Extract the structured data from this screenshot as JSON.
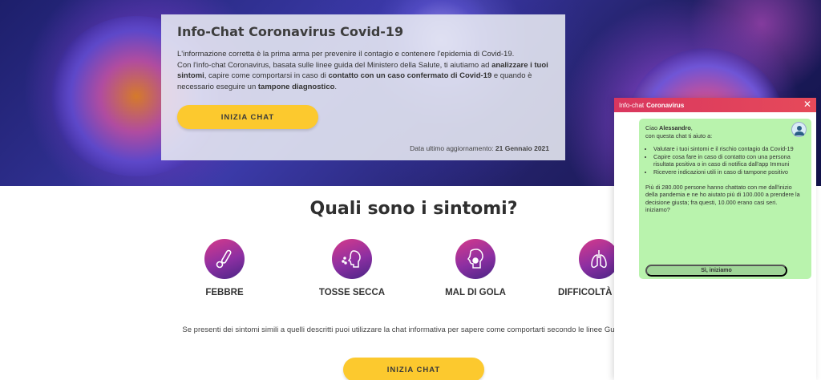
{
  "hero": {
    "title": "Info-Chat Coronavirus Covid-19",
    "paragraph": {
      "line1": "L'informazione corretta è la prima arma per prevenire il contagio e contenere l'epidemia di Covid-19.",
      "seg1": "Con l'info-chat Coronavirus, basata sulle linee guida del Ministero della Salute, ti aiutiamo ad ",
      "b1": "analizzare i tuoi sintomi",
      "seg2": ", capire come comportarsi in caso di ",
      "b2": "contatto con un caso confermato di Covid-19",
      "seg3": " e quando è necessario eseguire un ",
      "b3": "tampone diagnostico",
      "seg4": "."
    },
    "cta_label": "INIZIA CHAT",
    "update_prefix": "Data ultimo aggiornamento: ",
    "update_date": "21 Gennaio 2021"
  },
  "symptoms": {
    "title": "Quali sono i sintomi?",
    "items": [
      {
        "label": "FEBBRE",
        "icon": "thermometer-icon"
      },
      {
        "label": "TOSSE SECCA",
        "icon": "cough-icon"
      },
      {
        "label": "MAL DI GOLA",
        "icon": "sore-throat-icon"
      },
      {
        "label": "DIFFICOLTÀ RESP",
        "icon": "lungs-icon"
      }
    ],
    "description": "Se presenti dei sintomi simili a quelli descritti puoi utilizzare la chat informativa per sapere come comportarti secondo le linee Guida della salute.",
    "cta_label": "INIZIA CHAT"
  },
  "chat": {
    "header_prefix": "Info-chat",
    "header_bold": "Coronavirus",
    "close_icon": "close-icon",
    "greeting_prefix": "Ciao ",
    "user_name": "Alessandro",
    "greeting_suffix": ",",
    "intro": "con questa chat ti aiuto a:",
    "bullets": [
      "Valutare i tuoi sintomi e il rischio contagio da Covid-19",
      "Capire cosa fare in caso di contatto con una persona risultata positiva o in caso di notifica dall'app Immuni",
      "Ricevere indicazioni utili in caso di tampone positivo"
    ],
    "stats": "Più di 280.000 persone hanno chattato con me dall'inizio della pandemia e ne ho aiutato più di 100.000 a prendere la decisione giusta; fra questi, 10.000 erano casi seri.",
    "question": "iniziamo?",
    "start_label": "Sì, iniziamo",
    "avatar_icon": "doctor-avatar-icon"
  },
  "colors": {
    "accent_yellow": "#fcc92e",
    "chat_header": "#d9365f",
    "chat_bubble": "#b9f3ad",
    "icon_gradient_start": "#d63a8a",
    "icon_gradient_end": "#4a2585"
  }
}
